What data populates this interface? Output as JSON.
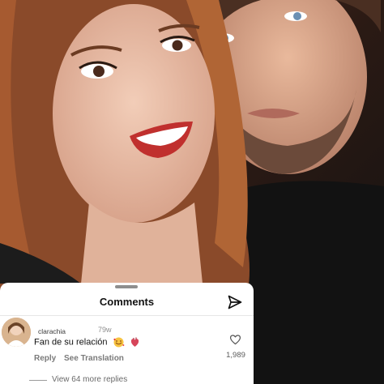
{
  "sheet": {
    "title": "Comments"
  },
  "comment": {
    "username": "clarachia",
    "timestamp": "79w",
    "text": "Fan de su relación",
    "emojis": [
      "smiling-face-with-hearts",
      "anatomical-heart"
    ],
    "reply_label": "Reply",
    "translation_label": "See Translation",
    "like_count": "1,989",
    "view_replies_label": "View 64 more replies"
  },
  "colors": {
    "sheet_bg": "#ffffff",
    "text_primary": "#111111",
    "text_secondary": "#7a7a7a",
    "grabber": "#8e8e8e"
  },
  "icons": {
    "send": "paper-plane-icon",
    "like": "heart-outline-icon"
  }
}
